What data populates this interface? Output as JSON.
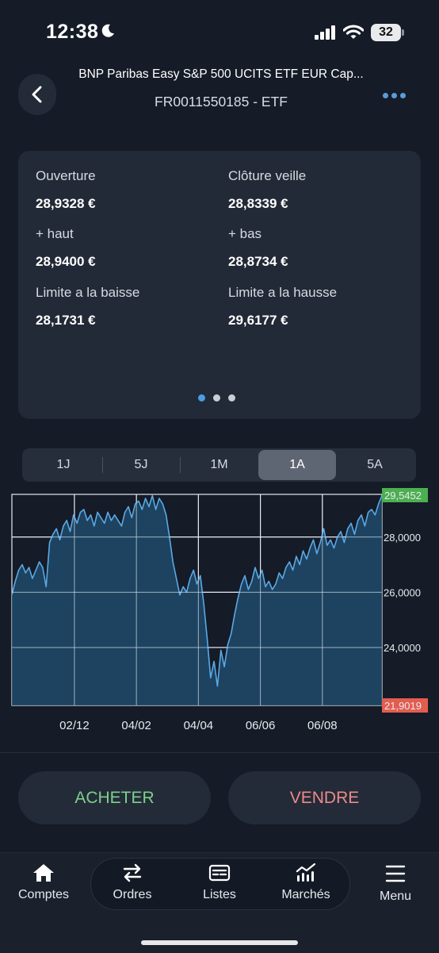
{
  "status": {
    "time": "12:38",
    "battery": "32"
  },
  "header": {
    "title": "BNP Paribas Easy S&P 500 UCITS ETF EUR Cap...",
    "subtitle": "FR0011550185 - ETF"
  },
  "stats": {
    "open_label": "Ouverture",
    "open_value": "28,9328 €",
    "prev_close_label": "Clôture veille",
    "prev_close_value": "28,8339 €",
    "high_label": "+ haut",
    "high_value": "28,9400 €",
    "low_label": "+ bas",
    "low_value": "28,8734 €",
    "lower_limit_label": "Limite a la baisse",
    "lower_limit_value": "28,1731 €",
    "upper_limit_label": "Limite a la hausse",
    "upper_limit_value": "29,6177 €"
  },
  "periods": [
    "1J",
    "5J",
    "1M",
    "1A",
    "5A"
  ],
  "selected_period": "1A",
  "chart_data": {
    "type": "area",
    "x_tick_labels": [
      "02/12",
      "04/02",
      "04/04",
      "06/06",
      "06/08"
    ],
    "y_tick_labels": [
      "28,0000",
      "26,0000",
      "24,0000"
    ],
    "max_label": "29,5452",
    "min_label": "21,9019",
    "ylim": [
      21.9019,
      29.5452
    ],
    "grid": true,
    "colors": {
      "line": "#5aa9e6",
      "fill": "#1e4a6b",
      "max_badge": "#4caf50",
      "min_badge": "#e35d4f"
    },
    "series": [
      {
        "values": [
          25.9,
          26.4,
          26.8,
          27.0,
          26.7,
          26.9,
          26.5,
          26.8,
          27.1,
          26.9,
          26.2,
          27.8,
          28.1,
          28.3,
          27.9,
          28.4,
          28.6,
          28.2,
          28.8,
          28.5,
          28.9,
          29.0,
          28.6,
          28.8,
          28.4,
          28.9,
          28.7,
          28.5,
          28.9,
          28.6,
          28.8,
          28.6,
          28.4,
          28.9,
          29.1,
          28.7,
          29.2,
          29.3,
          29.0,
          29.4,
          29.1,
          29.5,
          29.0,
          29.4,
          29.2,
          28.8,
          28.0,
          27.1,
          26.5,
          25.9,
          26.2,
          26.0,
          26.5,
          26.8,
          26.3,
          26.6,
          25.6,
          24.3,
          22.9,
          23.5,
          22.6,
          23.9,
          23.3,
          24.1,
          24.5,
          25.2,
          25.8,
          26.3,
          26.6,
          26.1,
          26.4,
          26.9,
          26.5,
          26.8,
          26.2,
          26.4,
          26.1,
          26.3,
          26.7,
          26.5,
          26.9,
          27.1,
          26.8,
          27.3,
          27.0,
          27.5,
          27.2,
          27.6,
          27.9,
          27.4,
          27.8,
          28.3,
          27.7,
          27.9,
          27.6,
          28.0,
          28.2,
          27.8,
          28.3,
          28.5,
          28.1,
          28.6,
          28.8,
          28.4,
          28.9,
          29.0,
          28.8,
          29.2,
          29.5
        ]
      }
    ]
  },
  "actions": {
    "buy": "ACHETER",
    "sell": "VENDRE"
  },
  "tabs": [
    {
      "label": "Comptes",
      "icon": "home-icon"
    },
    {
      "label": "Ordres",
      "icon": "swap-arrows-icon"
    },
    {
      "label": "Listes",
      "icon": "card-list-icon"
    },
    {
      "label": "Marchés",
      "icon": "market-chart-icon"
    },
    {
      "label": "Menu",
      "icon": "hamburger-icon"
    }
  ]
}
